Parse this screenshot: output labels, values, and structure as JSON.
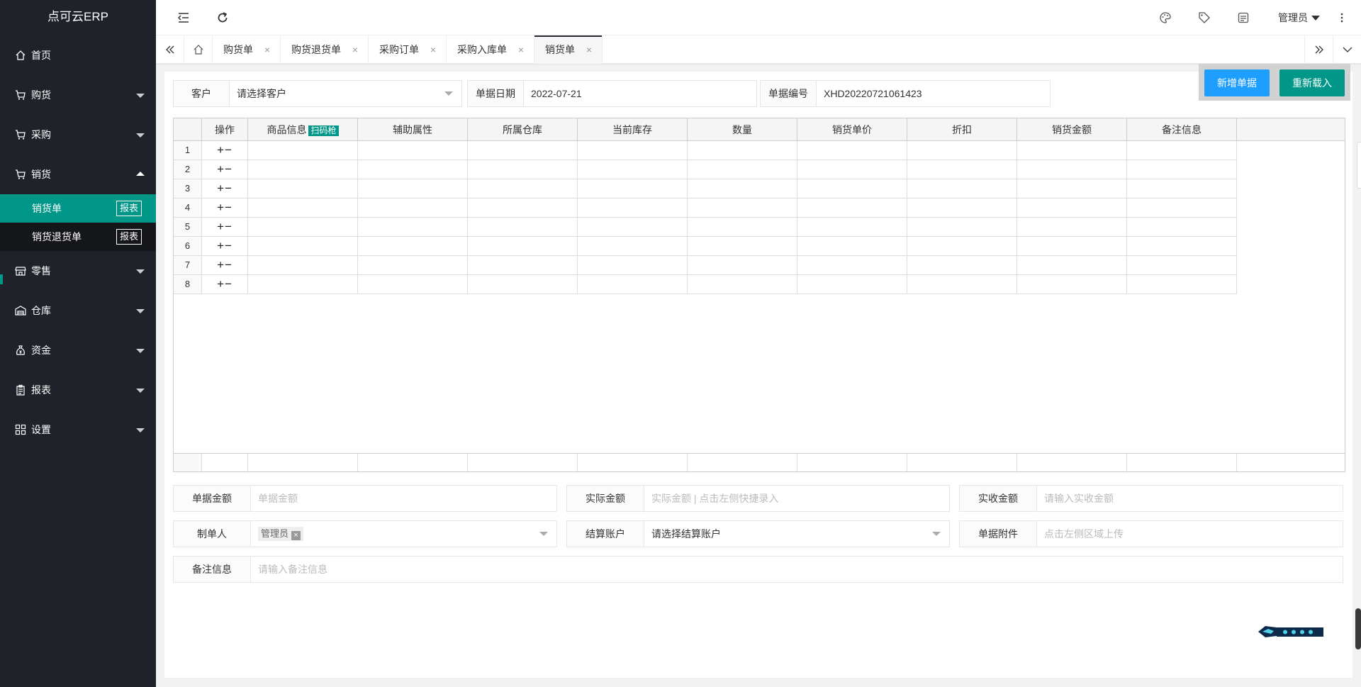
{
  "app": {
    "title": "点可云ERP"
  },
  "sidebar": {
    "items": [
      {
        "label": "首页",
        "icon": "home-icon",
        "expandable": false
      },
      {
        "label": "购货",
        "icon": "cart-icon",
        "expandable": true
      },
      {
        "label": "采购",
        "icon": "cart-icon",
        "expandable": true
      },
      {
        "label": "销货",
        "icon": "cart-icon",
        "expandable": true,
        "expanded": true,
        "children": [
          {
            "label": "销货单",
            "badge": "报表",
            "active": true
          },
          {
            "label": "销货退货单",
            "badge": "报表",
            "active": false
          }
        ]
      },
      {
        "label": "零售",
        "icon": "store-icon",
        "expandable": true
      },
      {
        "label": "仓库",
        "icon": "warehouse-icon",
        "expandable": true
      },
      {
        "label": "资金",
        "icon": "money-bag-icon",
        "expandable": true
      },
      {
        "label": "报表",
        "icon": "clipboard-icon",
        "expandable": true
      },
      {
        "label": "设置",
        "icon": "grid-icon",
        "expandable": true
      }
    ]
  },
  "header": {
    "user_label": "管理员",
    "icons": [
      "menu-toggle-icon",
      "refresh-icon",
      "palette-icon",
      "tag-icon",
      "note-icon",
      "more-vertical-icon"
    ]
  },
  "tabs": {
    "items": [
      {
        "label": "购货单",
        "active": false
      },
      {
        "label": "购货退货单",
        "active": false
      },
      {
        "label": "采购订单",
        "active": false
      },
      {
        "label": "采购入库单",
        "active": false
      },
      {
        "label": "销货单",
        "active": true
      }
    ],
    "close_glyph": "×"
  },
  "form": {
    "customer": {
      "label": "客户",
      "placeholder": "请选择客户"
    },
    "date": {
      "label": "单据日期",
      "value": "2022-07-21"
    },
    "number": {
      "label": "单据编号",
      "value": "XHD20220721061423"
    }
  },
  "actions": {
    "new_label": "新增单据",
    "reload_label": "重新载入"
  },
  "grid": {
    "columns": [
      "操作",
      "商品信息",
      "辅助属性",
      "所属仓库",
      "当前库存",
      "数量",
      "销货单价",
      "折扣",
      "销货金额",
      "备注信息"
    ],
    "scan_tag": "扫码枪",
    "op_glyph": "+−",
    "row_numbers": [
      "1",
      "2",
      "3",
      "4",
      "5",
      "6",
      "7",
      "8"
    ]
  },
  "summary": {
    "bill_amount": {
      "label": "单据金额",
      "placeholder": "单据金额"
    },
    "actual_amount": {
      "label": "实际金额",
      "placeholder": "实际金额 | 点击左侧快捷录入"
    },
    "received_amount": {
      "label": "实收金额",
      "placeholder": "请输入实收金额"
    },
    "maker": {
      "label": "制单人",
      "value": "管理员",
      "remove_glyph": "×"
    },
    "account": {
      "label": "结算账户",
      "placeholder": "请选择结算账户"
    },
    "attachment": {
      "label": "单据附件",
      "placeholder": "点击左侧区域上传"
    },
    "remark": {
      "label": "备注信息",
      "placeholder": "请输入备注信息"
    }
  },
  "colors": {
    "sidebar_bg": "#20222a",
    "accent": "#009688",
    "primary": "#1e9fff"
  }
}
